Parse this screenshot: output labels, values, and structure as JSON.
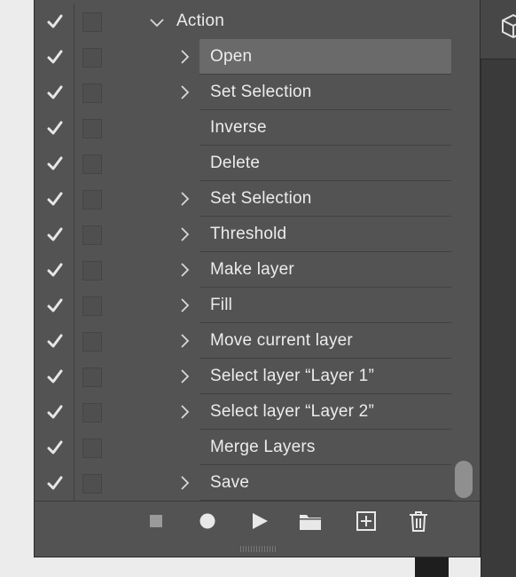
{
  "panel": "actions",
  "rows": [
    {
      "label": "Action",
      "level": 0,
      "expanded": true,
      "has_chevron": true,
      "selected": false
    },
    {
      "label": "Open",
      "level": 1,
      "has_chevron": true,
      "selected": true
    },
    {
      "label": "Set Selection",
      "level": 1,
      "has_chevron": true,
      "selected": false
    },
    {
      "label": "Inverse",
      "level": 1,
      "has_chevron": false,
      "selected": false
    },
    {
      "label": "Delete",
      "level": 1,
      "has_chevron": false,
      "selected": false
    },
    {
      "label": "Set Selection",
      "level": 1,
      "has_chevron": true,
      "selected": false
    },
    {
      "label": "Threshold",
      "level": 1,
      "has_chevron": true,
      "selected": false
    },
    {
      "label": "Make layer",
      "level": 1,
      "has_chevron": true,
      "selected": false
    },
    {
      "label": "Fill",
      "level": 1,
      "has_chevron": true,
      "selected": false
    },
    {
      "label": "Move current layer",
      "level": 1,
      "has_chevron": true,
      "selected": false
    },
    {
      "label": "Select layer “Layer 1”",
      "level": 1,
      "has_chevron": true,
      "selected": false
    },
    {
      "label": "Select layer “Layer 2”",
      "level": 1,
      "has_chevron": true,
      "selected": false
    },
    {
      "label": "Merge Layers",
      "level": 1,
      "has_chevron": false,
      "selected": false
    },
    {
      "label": "Save",
      "level": 1,
      "has_chevron": true,
      "selected": false
    }
  ],
  "toolbar": {
    "buttons": [
      "stop-icon",
      "record-icon",
      "play-icon",
      "new-set-icon",
      "new-action-icon",
      "delete-icon"
    ]
  },
  "colors": {
    "panel_bg": "#535353",
    "selected_bg": "#6a6a6a",
    "text": "#ececec"
  }
}
